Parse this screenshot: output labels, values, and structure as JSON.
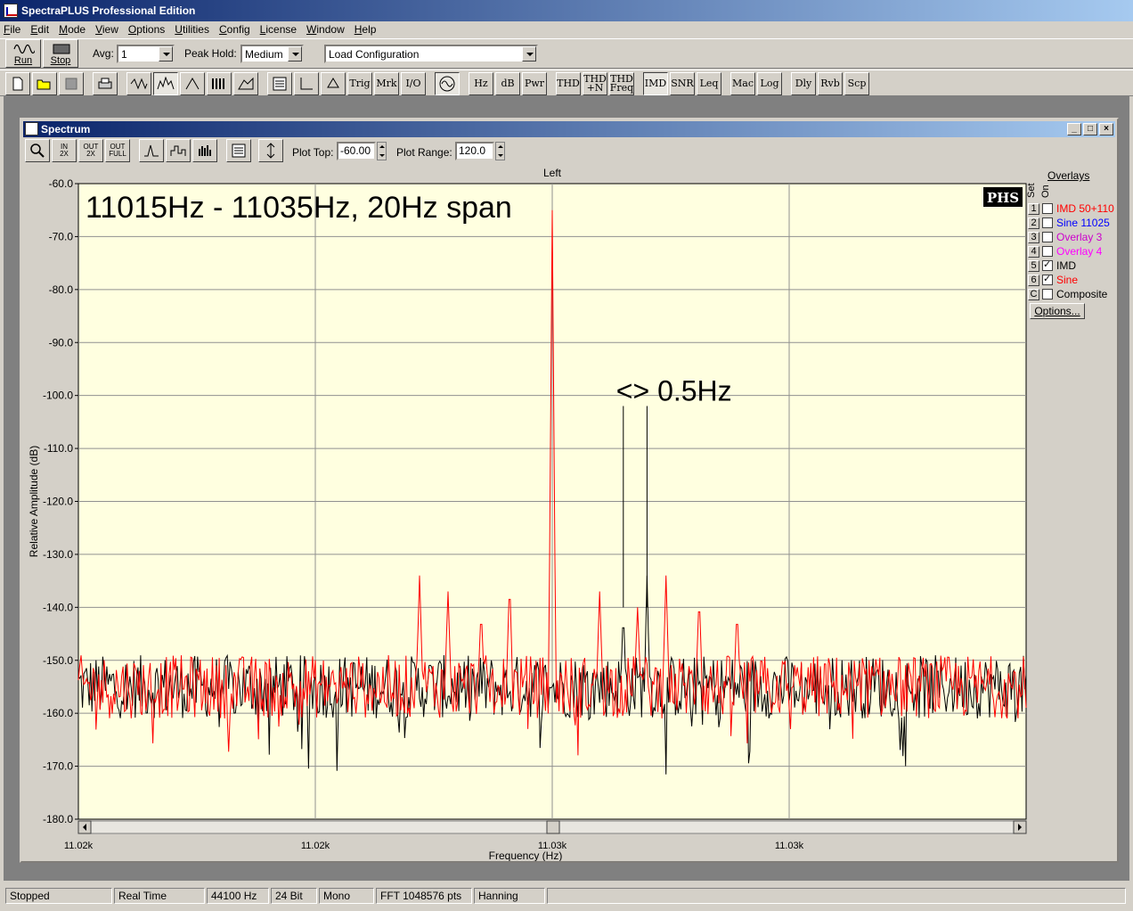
{
  "app": {
    "title": "SpectraPLUS Professional Edition"
  },
  "menu": [
    "File",
    "Edit",
    "Mode",
    "View",
    "Options",
    "Utilities",
    "Config",
    "License",
    "Window",
    "Help"
  ],
  "toolbar": {
    "run_label": "Run",
    "stop_label": "Stop",
    "avg_label": "Avg:",
    "avg_value": "1",
    "peak_hold_label": "Peak Hold:",
    "peak_hold_value": "Medium",
    "config_value": "Load Configuration",
    "buttons": [
      "Trig",
      "Mrk",
      "I/O",
      "Hz",
      "dB",
      "Pwr",
      "THD",
      "THD\n+N",
      "THD\nFreq",
      "IMD",
      "SNR",
      "Leq",
      "Mac",
      "Log",
      "Dly",
      "Rvb",
      "Scp"
    ]
  },
  "spectrum": {
    "window_title": "Spectrum",
    "plot_top_label": "Plot Top:",
    "plot_top_value": "-60.00",
    "plot_range_label": "Plot Range:",
    "plot_range_value": "120.0",
    "small_buttons": [
      "IN\n2X",
      "OUT\n2X",
      "OUT\nFULL"
    ]
  },
  "overlays": {
    "title": "Overlays",
    "col_set": "Set",
    "col_on": "On",
    "options_label": "Options...",
    "items": [
      {
        "key": "1",
        "label": "IMD 50+110",
        "on": false,
        "color": "#ff0000"
      },
      {
        "key": "2",
        "label": "Sine 11025",
        "on": false,
        "color": "#0000ff"
      },
      {
        "key": "3",
        "label": "Overlay 3",
        "on": false,
        "color": "#cc00cc"
      },
      {
        "key": "4",
        "label": "Overlay 4",
        "on": false,
        "color": "#ff00ff"
      },
      {
        "key": "5",
        "label": "IMD",
        "on": true,
        "color": "#000000"
      },
      {
        "key": "6",
        "label": "Sine",
        "on": true,
        "color": "#ff0000"
      },
      {
        "key": "C",
        "label": "Composite",
        "on": false,
        "color": "#000000"
      }
    ]
  },
  "chart_data": {
    "type": "line",
    "title": "Left",
    "xlabel": "Frequency (Hz)",
    "ylabel": "Relative Amplitude (dB)",
    "ylim": [
      -180,
      -60
    ],
    "xlim": [
      11015,
      11035
    ],
    "yticks": [
      "-60.0",
      "-70.0",
      "-80.0",
      "-90.0",
      "-100.0",
      "-110.0",
      "-120.0",
      "-130.0",
      "-140.0",
      "-150.0",
      "-160.0",
      "-170.0",
      "-180.0"
    ],
    "xticks": [
      "11.02k",
      "11.02k",
      "11.03k",
      "11.03k"
    ],
    "xtick_values": [
      11015,
      11020,
      11025,
      11030
    ],
    "grid": true,
    "annotation_main": "11015Hz - 11035Hz, 20Hz span",
    "annotation_marker": "<> 0.5Hz",
    "logo": "PHS",
    "series": [
      {
        "name": "Sine",
        "color": "#ff0000",
        "peak_hz": 11025,
        "peak_db": -65,
        "noise_floor_db": -155
      },
      {
        "name": "IMD",
        "color": "#000000",
        "marker_hz": [
          11026.5,
          11027.0
        ],
        "noise_floor_db": -155
      }
    ]
  },
  "status": [
    "Stopped",
    "Real Time",
    "44100 Hz",
    "24 Bit",
    "Mono",
    "FFT 1048576 pts",
    "Hanning"
  ]
}
